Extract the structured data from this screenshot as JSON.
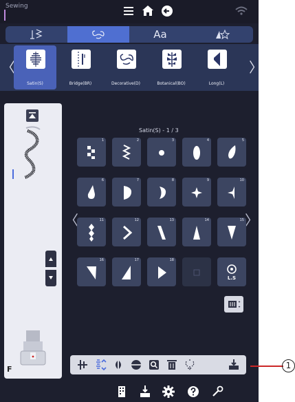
{
  "status_bar": {
    "mode": "Sewing",
    "icons": [
      "menu-icon",
      "home-icon",
      "return-icon",
      "wifi-icon"
    ]
  },
  "category_tabs": [
    {
      "icon": "utility-stitch-icon",
      "active": false
    },
    {
      "icon": "decorative-stitch-icon",
      "active": true
    },
    {
      "icon": "",
      "label": "Aa",
      "active": false
    },
    {
      "icon": "my-stitch-icon",
      "active": false
    }
  ],
  "sub_categories": [
    {
      "label": "Satin(S)",
      "active": true
    },
    {
      "label": "Bridge(BR)",
      "active": false
    },
    {
      "label": "Decorative(D)",
      "active": false
    },
    {
      "label": "Botanical(BO)",
      "active": false
    },
    {
      "label": "Long(L)",
      "active": false
    }
  ],
  "pattern_area": {
    "page_info": "Satin(S) - 1 / 3",
    "patterns": [
      {
        "num": "1",
        "shape": "checker"
      },
      {
        "num": "2",
        "shape": "zigzag"
      },
      {
        "num": "3",
        "shape": "dot"
      },
      {
        "num": "4",
        "shape": "oval"
      },
      {
        "num": "5",
        "shape": "teardrop"
      },
      {
        "num": "6",
        "shape": "drop-left"
      },
      {
        "num": "7",
        "shape": "half-moon"
      },
      {
        "num": "8",
        "shape": "crescent"
      },
      {
        "num": "9",
        "shape": "star4"
      },
      {
        "num": "10",
        "shape": "star-half"
      },
      {
        "num": "11",
        "shape": "diamonds"
      },
      {
        "num": "12",
        "shape": "chevron"
      },
      {
        "num": "13",
        "shape": "slant-bar"
      },
      {
        "num": "14",
        "shape": "triangle-up"
      },
      {
        "num": "15",
        "shape": "triangle-down"
      },
      {
        "num": "16",
        "shape": "right-tri-left"
      },
      {
        "num": "17",
        "shape": "right-tri-right"
      },
      {
        "num": "18",
        "shape": "play"
      },
      {
        "num": "",
        "shape": "empty"
      },
      {
        "num": "",
        "shape": "ls",
        "label": "L.S"
      }
    ]
  },
  "presser_foot": {
    "code": "F"
  },
  "edit_toolbar": [
    "mirror-icon",
    "elongation-icon",
    "symmetry-icon",
    "density-icon",
    "zoom-icon",
    "delete-icon",
    "combine-icon",
    "set-icon"
  ],
  "bottom_nav": [
    "pattern-list-icon",
    "download-icon",
    "settings-icon",
    "help-icon",
    "tool-icon"
  ],
  "callout": {
    "number": "1"
  },
  "colors": {
    "background": "#1d1f2e",
    "accent": "#4f6fd1",
    "callout_line": "#cc2727"
  }
}
